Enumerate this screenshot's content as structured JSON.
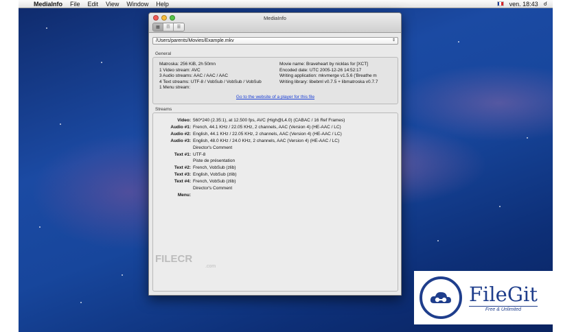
{
  "menubar": {
    "app_name": "MediaInfo",
    "items": [
      "File",
      "Edit",
      "View",
      "Window",
      "Help"
    ],
    "clock": "ven. 18:43",
    "flag_colors": [
      "#1f3e99",
      "#ffffff",
      "#d8232a"
    ]
  },
  "window": {
    "title": "MediaInfo",
    "path": "/Users/parents/Movies/Example.mkv",
    "general_label": "General",
    "general_left": [
      "Matroska: 256 KiB, 2h 50mn",
      "1 Video stream: AVC",
      "3 Audio streams: AAC / AAC / AAC",
      "4 Text streams: UTF-8 / VobSub / VobSub / VobSub",
      "1 Menu stream:"
    ],
    "general_right": [
      "Movie name: Braveheart by nicklas for [XCT]",
      "Encoded date: UTC 2005-12-26 14:52:17",
      "Writing application: mkvmerge v1.5.6 ('Breathe m",
      "Writing library: libebml v0.7.5 + libmatroska v0.7.7"
    ],
    "website_link": "Go to the website of a player for this file",
    "streams_label": "Streams",
    "streams": [
      {
        "label": "Video:",
        "value": "560*240 (2.35:1), at 12.500 fps, AVC (High@L4.0) (CABAC / 16 Ref Frames)"
      },
      {
        "label": "Audio #1:",
        "value": "French, 44.1 KHz / 22.05 KHz, 2 channels, AAC (Version 4) (HE-AAC / LC)"
      },
      {
        "label": "Audio #2:",
        "value": "English, 44.1 KHz / 22.05 KHz, 2 channels, AAC (Version 4) (HE-AAC / LC)"
      },
      {
        "label": "Audio #3:",
        "value": "English, 48.0 KHz / 24.0 KHz, 2 channels, AAC (Version 4) (HE-AAC / LC)"
      },
      {
        "label": "",
        "value": "Director's Comment"
      },
      {
        "label": "Text #1:",
        "value": "UTF-8"
      },
      {
        "label": "",
        "value": "Piste de présentation"
      },
      {
        "label": "Text #2:",
        "value": "French, VobSub (zlib)"
      },
      {
        "label": "Text #3:",
        "value": "English, VobSub (zlib)"
      },
      {
        "label": "Text #4:",
        "value": "French, VobSub (zlib)"
      },
      {
        "label": "",
        "value": "Director's Comment"
      },
      {
        "label": "Menu:",
        "value": ""
      }
    ]
  },
  "watermark": {
    "brand": "FILECR",
    "suffix": ".com"
  },
  "badge": {
    "title": "FileGit",
    "subtitle": "Free & Unlimited",
    "color": "#1f3e8c"
  }
}
